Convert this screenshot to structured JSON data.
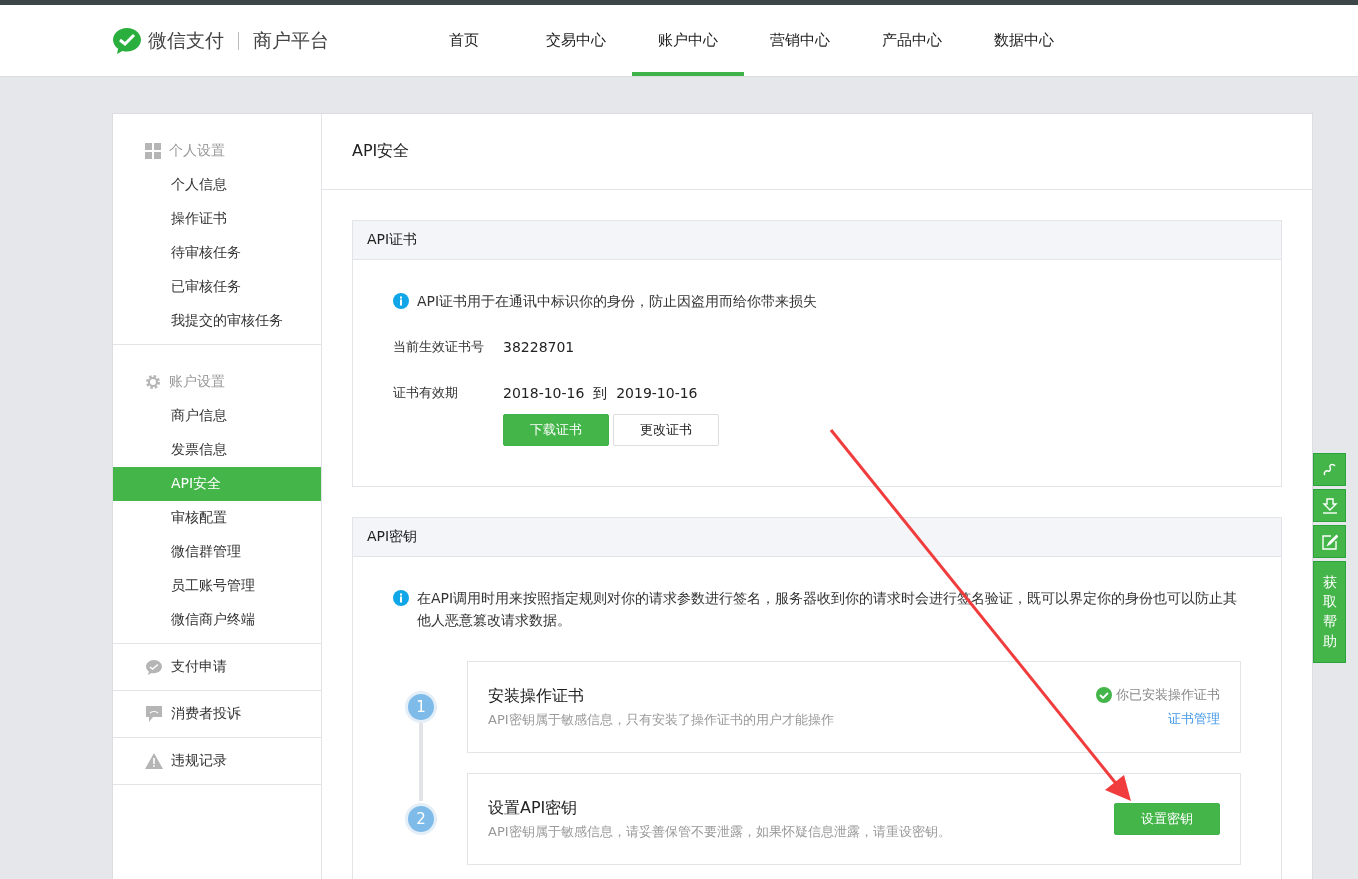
{
  "header": {
    "logo_text": "微信支付",
    "platform": "商户平台",
    "nav": [
      {
        "label": "首页",
        "selected": false
      },
      {
        "label": "交易中心",
        "selected": false
      },
      {
        "label": "账户中心",
        "selected": true
      },
      {
        "label": "营销中心",
        "selected": false
      },
      {
        "label": "产品中心",
        "selected": false
      },
      {
        "label": "数据中心",
        "selected": false
      }
    ]
  },
  "sidebar": {
    "groups": [
      {
        "label": "个人设置",
        "items": [
          {
            "label": "个人信息",
            "selected": false
          },
          {
            "label": "操作证书",
            "selected": false
          },
          {
            "label": "待审核任务",
            "selected": false
          },
          {
            "label": "已审核任务",
            "selected": false
          },
          {
            "label": "我提交的审核任务",
            "selected": false
          }
        ]
      },
      {
        "label": "账户设置",
        "items": [
          {
            "label": "商户信息",
            "selected": false
          },
          {
            "label": "发票信息",
            "selected": false
          },
          {
            "label": "API安全",
            "selected": true
          },
          {
            "label": "审核配置",
            "selected": false
          },
          {
            "label": "微信群管理",
            "selected": false
          },
          {
            "label": "员工账号管理",
            "selected": false
          },
          {
            "label": "微信商户终端",
            "selected": false
          }
        ]
      },
      {
        "label": "支付申请"
      },
      {
        "label": "消费者投诉"
      },
      {
        "label": "违规记录"
      }
    ]
  },
  "page_title": "API安全",
  "certificate": {
    "title": "API证书",
    "info": "API证书用于在通讯中标识你的身份，防止因盗用而给你带来损失",
    "fields": [
      {
        "label": "当前生效证书号",
        "value": "38228701"
      },
      {
        "label": "证书有效期",
        "value": "2018-10-16  到  2019-10-16"
      }
    ],
    "buttons": [
      {
        "label": "下载证书",
        "kind": "primary"
      },
      {
        "label": "更改证书",
        "kind": "default"
      }
    ]
  },
  "api_key": {
    "title": "API密钥",
    "info": "在API调用时用来按照指定规则对你的请求参数进行签名，服务器收到你的请求时会进行签名验证，既可以界定你的身份也可以防止其他人恶意篡改请求数据。",
    "steps": [
      {
        "number": "1",
        "title": "安装操作证书",
        "description": "API密钥属于敏感信息，只有安装了操作证书的用户才能操作",
        "kind": "status",
        "status": "你已安装操作证书",
        "link": "证书管理"
      },
      {
        "number": "2",
        "title": "设置API密钥",
        "description": "API密钥属于敏感信息，请妥善保管不要泄露，如果怀疑信息泄露，请重设密钥。",
        "kind": "button",
        "button": "设置密钥"
      }
    ]
  },
  "float_tools": [
    {
      "kind": "link"
    },
    {
      "kind": "download"
    },
    {
      "kind": "edit"
    },
    {
      "kind": "text",
      "label": "获取帮助"
    }
  ]
}
